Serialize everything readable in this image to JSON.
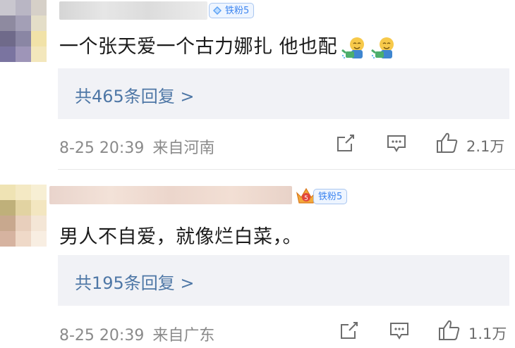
{
  "comments": [
    {
      "badge": "铁粉5",
      "text": "一个张天爱一个古力娜扎 他也配",
      "emoji_icons": [
        "watering-emoji-icon",
        "watering-emoji-icon"
      ],
      "replies_label": "共465条回复 >",
      "date": "8-25 20:39",
      "location": "来自河南",
      "likes": "2.1万"
    },
    {
      "badge": "铁粉5",
      "text": "男人不自爱，就像烂白菜，。",
      "replies_label": "共195条回复 >",
      "date": "8-25 20:39",
      "location": "来自广东",
      "likes": "1.1万"
    }
  ],
  "colors": {
    "link": "#4e77a6",
    "badge_text": "#3f86f0",
    "meta": "#8a8a8a",
    "reply_bg": "#f1f2f6"
  }
}
